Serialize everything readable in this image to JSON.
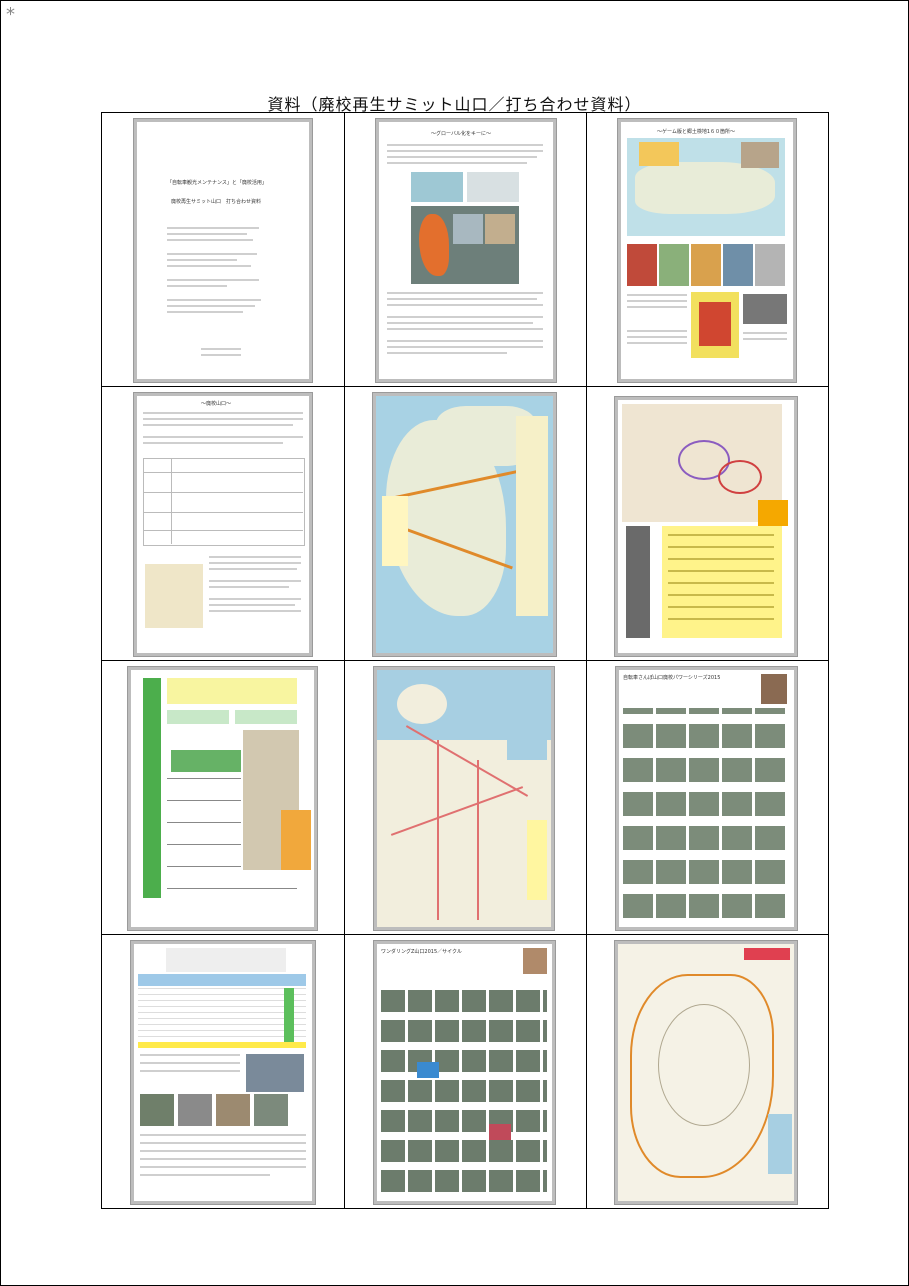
{
  "corner_mark": "*",
  "title": "資料（廃校再生サミット山口／打ち合わせ資料）",
  "thumbnails": [
    {
      "id": "cover",
      "heading": "「自転車観光メンテナンス」と「廃校活用」",
      "subheading": "廃校再生サミット山口　打ち合わせ資料"
    },
    {
      "id": "global",
      "heading": "〜グローバル化をキーに〜"
    },
    {
      "id": "game",
      "heading": "〜ゲーム版と郷土検地1６０箇所〜"
    },
    {
      "id": "history",
      "heading": "〜廃校山口〜"
    },
    {
      "id": "map-island"
    },
    {
      "id": "map-detail"
    },
    {
      "id": "timeline"
    },
    {
      "id": "city-map"
    },
    {
      "id": "photo-list-2015",
      "heading": "自転車さんぽ山口廃校パワーシリーズ2015"
    },
    {
      "id": "table-sheet"
    },
    {
      "id": "photo-list-2",
      "heading": "ワンダリングZ山口2015／サイクル"
    },
    {
      "id": "topo-map"
    }
  ]
}
